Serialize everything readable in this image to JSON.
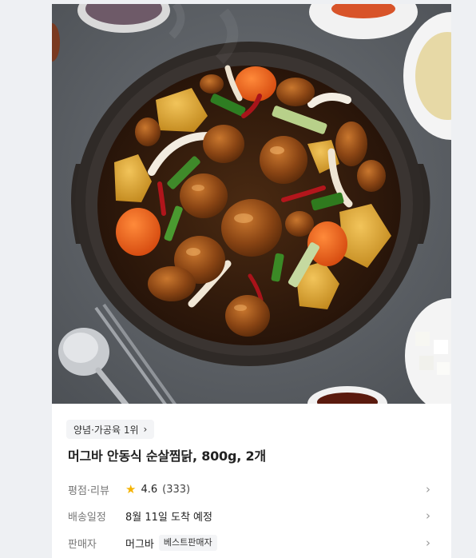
{
  "hero": {
    "icon": "food-photo",
    "subject": "braised-chicken-pot"
  },
  "category_chip": {
    "label": "양념·가공육 1위",
    "chevron_icon": "chevron-right-icon"
  },
  "product": {
    "title": "머그바 안동식 순살찜닭, 800g, 2개"
  },
  "rating_row": {
    "label": "평점·리뷰",
    "star_icon": "star-icon",
    "rating": "4.6",
    "review_count": "(333)"
  },
  "delivery_row": {
    "label": "배송일정",
    "value": "8월 11일 도착 예정"
  },
  "seller_row": {
    "label": "판매자",
    "value": "머그바",
    "badge": "베스트판매자"
  },
  "colors": {
    "star": "#f5b301",
    "chip_bg": "#f3f4f6",
    "label_text": "#777777",
    "arrow": "#999999"
  }
}
